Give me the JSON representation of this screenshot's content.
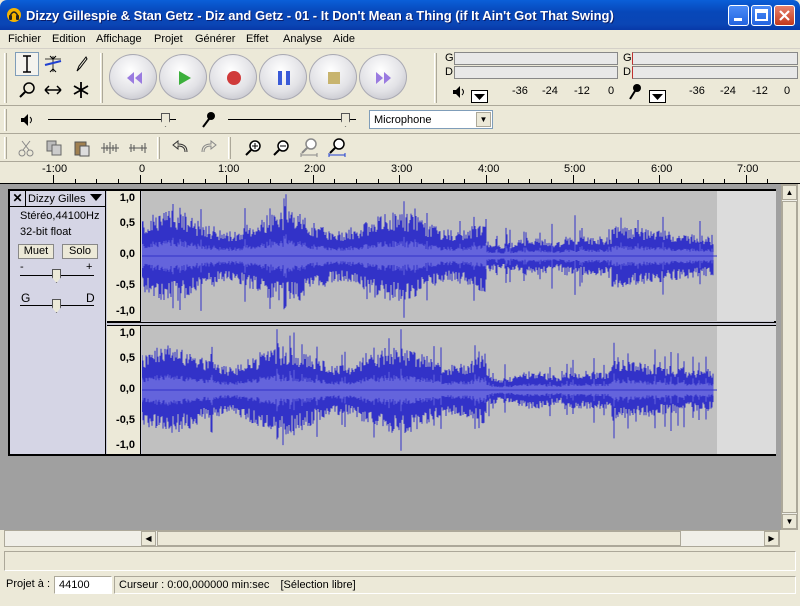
{
  "window": {
    "title": "Dizzy Gillespie & Stan Getz - Diz and Getz - 01 - It Don't Mean a Thing (if It Ain't Got That Swing)"
  },
  "menu": [
    {
      "label": "Fichier"
    },
    {
      "label": "Edition"
    },
    {
      "label": "Affichage"
    },
    {
      "label": "Projet"
    },
    {
      "label": "Générer"
    },
    {
      "label": "Effet"
    },
    {
      "label": "Analyse"
    },
    {
      "label": "Aide"
    }
  ],
  "tools": [
    "selection-tool",
    "envelope-tool",
    "draw-tool",
    "zoom-tool",
    "time-shift-tool",
    "multi-tool"
  ],
  "transport": [
    "skip-start",
    "play",
    "record",
    "pause",
    "stop",
    "skip-end"
  ],
  "meters": {
    "playback": {
      "channel_left": "G",
      "channel_right": "D",
      "scale": [
        "-36",
        "-24",
        "-12",
        "0"
      ]
    },
    "record": {
      "channel_left": "G",
      "channel_right": "D",
      "scale": [
        "-36",
        "-24",
        "-12",
        "0"
      ]
    }
  },
  "mixer": {
    "input_source": "Microphone"
  },
  "ruler": {
    "labels": [
      "-1:00",
      "0",
      "1:00",
      "2:00",
      "3:00",
      "4:00",
      "5:00",
      "6:00",
      "7:00"
    ]
  },
  "track": {
    "name": "Dizzy Gilles",
    "format": "Stéréo,44100Hz",
    "bitdepth": "32-bit float",
    "mute_label": "Muet",
    "solo_label": "Solo",
    "gain_minus": "-",
    "gain_plus": "+",
    "pan_left": "G",
    "pan_right": "D",
    "amplitude_labels": [
      "1,0",
      "0,5",
      "0,0",
      "-0,5",
      "-1,0"
    ]
  },
  "status": {
    "project_rate_label": "Projet à :",
    "project_rate": "44100",
    "cursor_text": "Curseur : 0:00,000000 min:sec",
    "selection_mode": "[Sélection libre]"
  },
  "colors": {
    "waveform": "#3232c8",
    "waveform_rms": "#6464dc",
    "titlebar": "#0a5fd8"
  }
}
